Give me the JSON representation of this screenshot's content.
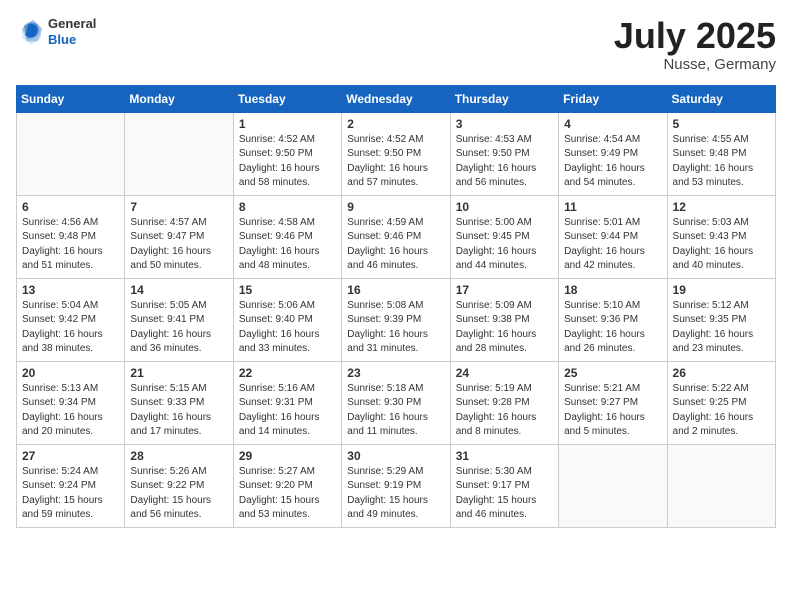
{
  "header": {
    "logo_general": "General",
    "logo_blue": "Blue",
    "month_title": "July 2025",
    "subtitle": "Nusse, Germany"
  },
  "weekdays": [
    "Sunday",
    "Monday",
    "Tuesday",
    "Wednesday",
    "Thursday",
    "Friday",
    "Saturday"
  ],
  "weeks": [
    [
      {
        "day": "",
        "info": ""
      },
      {
        "day": "",
        "info": ""
      },
      {
        "day": "1",
        "info": "Sunrise: 4:52 AM\nSunset: 9:50 PM\nDaylight: 16 hours\nand 58 minutes."
      },
      {
        "day": "2",
        "info": "Sunrise: 4:52 AM\nSunset: 9:50 PM\nDaylight: 16 hours\nand 57 minutes."
      },
      {
        "day": "3",
        "info": "Sunrise: 4:53 AM\nSunset: 9:50 PM\nDaylight: 16 hours\nand 56 minutes."
      },
      {
        "day": "4",
        "info": "Sunrise: 4:54 AM\nSunset: 9:49 PM\nDaylight: 16 hours\nand 54 minutes."
      },
      {
        "day": "5",
        "info": "Sunrise: 4:55 AM\nSunset: 9:48 PM\nDaylight: 16 hours\nand 53 minutes."
      }
    ],
    [
      {
        "day": "6",
        "info": "Sunrise: 4:56 AM\nSunset: 9:48 PM\nDaylight: 16 hours\nand 51 minutes."
      },
      {
        "day": "7",
        "info": "Sunrise: 4:57 AM\nSunset: 9:47 PM\nDaylight: 16 hours\nand 50 minutes."
      },
      {
        "day": "8",
        "info": "Sunrise: 4:58 AM\nSunset: 9:46 PM\nDaylight: 16 hours\nand 48 minutes."
      },
      {
        "day": "9",
        "info": "Sunrise: 4:59 AM\nSunset: 9:46 PM\nDaylight: 16 hours\nand 46 minutes."
      },
      {
        "day": "10",
        "info": "Sunrise: 5:00 AM\nSunset: 9:45 PM\nDaylight: 16 hours\nand 44 minutes."
      },
      {
        "day": "11",
        "info": "Sunrise: 5:01 AM\nSunset: 9:44 PM\nDaylight: 16 hours\nand 42 minutes."
      },
      {
        "day": "12",
        "info": "Sunrise: 5:03 AM\nSunset: 9:43 PM\nDaylight: 16 hours\nand 40 minutes."
      }
    ],
    [
      {
        "day": "13",
        "info": "Sunrise: 5:04 AM\nSunset: 9:42 PM\nDaylight: 16 hours\nand 38 minutes."
      },
      {
        "day": "14",
        "info": "Sunrise: 5:05 AM\nSunset: 9:41 PM\nDaylight: 16 hours\nand 36 minutes."
      },
      {
        "day": "15",
        "info": "Sunrise: 5:06 AM\nSunset: 9:40 PM\nDaylight: 16 hours\nand 33 minutes."
      },
      {
        "day": "16",
        "info": "Sunrise: 5:08 AM\nSunset: 9:39 PM\nDaylight: 16 hours\nand 31 minutes."
      },
      {
        "day": "17",
        "info": "Sunrise: 5:09 AM\nSunset: 9:38 PM\nDaylight: 16 hours\nand 28 minutes."
      },
      {
        "day": "18",
        "info": "Sunrise: 5:10 AM\nSunset: 9:36 PM\nDaylight: 16 hours\nand 26 minutes."
      },
      {
        "day": "19",
        "info": "Sunrise: 5:12 AM\nSunset: 9:35 PM\nDaylight: 16 hours\nand 23 minutes."
      }
    ],
    [
      {
        "day": "20",
        "info": "Sunrise: 5:13 AM\nSunset: 9:34 PM\nDaylight: 16 hours\nand 20 minutes."
      },
      {
        "day": "21",
        "info": "Sunrise: 5:15 AM\nSunset: 9:33 PM\nDaylight: 16 hours\nand 17 minutes."
      },
      {
        "day": "22",
        "info": "Sunrise: 5:16 AM\nSunset: 9:31 PM\nDaylight: 16 hours\nand 14 minutes."
      },
      {
        "day": "23",
        "info": "Sunrise: 5:18 AM\nSunset: 9:30 PM\nDaylight: 16 hours\nand 11 minutes."
      },
      {
        "day": "24",
        "info": "Sunrise: 5:19 AM\nSunset: 9:28 PM\nDaylight: 16 hours\nand 8 minutes."
      },
      {
        "day": "25",
        "info": "Sunrise: 5:21 AM\nSunset: 9:27 PM\nDaylight: 16 hours\nand 5 minutes."
      },
      {
        "day": "26",
        "info": "Sunrise: 5:22 AM\nSunset: 9:25 PM\nDaylight: 16 hours\nand 2 minutes."
      }
    ],
    [
      {
        "day": "27",
        "info": "Sunrise: 5:24 AM\nSunset: 9:24 PM\nDaylight: 15 hours\nand 59 minutes."
      },
      {
        "day": "28",
        "info": "Sunrise: 5:26 AM\nSunset: 9:22 PM\nDaylight: 15 hours\nand 56 minutes."
      },
      {
        "day": "29",
        "info": "Sunrise: 5:27 AM\nSunset: 9:20 PM\nDaylight: 15 hours\nand 53 minutes."
      },
      {
        "day": "30",
        "info": "Sunrise: 5:29 AM\nSunset: 9:19 PM\nDaylight: 15 hours\nand 49 minutes."
      },
      {
        "day": "31",
        "info": "Sunrise: 5:30 AM\nSunset: 9:17 PM\nDaylight: 15 hours\nand 46 minutes."
      },
      {
        "day": "",
        "info": ""
      },
      {
        "day": "",
        "info": ""
      }
    ]
  ]
}
